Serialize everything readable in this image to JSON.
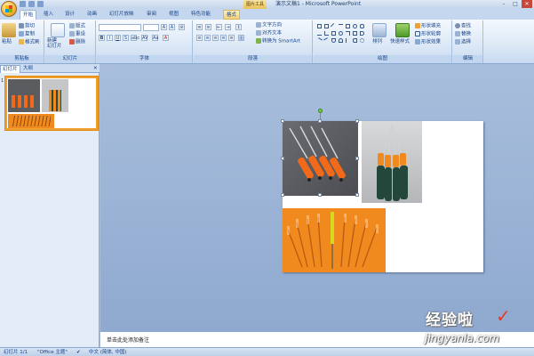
{
  "window": {
    "title": "演示文稿1 - Microsoft PowerPoint",
    "contextual_tab": "图片工具",
    "controls": {
      "minimize": "–",
      "maximize": "□",
      "close": "✕"
    }
  },
  "tabs": [
    "开始",
    "插入",
    "设计",
    "动画",
    "幻灯片放映",
    "审阅",
    "视图",
    "特色功能",
    "格式"
  ],
  "ribbon": {
    "clipboard": {
      "label": "剪贴板",
      "paste": "粘贴",
      "cut": "剪切",
      "copy": "复制",
      "format_painter": "格式刷"
    },
    "slides": {
      "label": "幻灯片",
      "new_slide": "新建\n幻灯片",
      "layout": "版式",
      "reset": "重设",
      "delete": "删除"
    },
    "font": {
      "label": "字体",
      "font_name": "",
      "font_size": ""
    },
    "paragraph": {
      "label": "段落",
      "text_direction": "文字方向",
      "align_text": "对齐文本",
      "smartart": "转换为 SmartArt"
    },
    "drawing": {
      "label": "绘图",
      "arrange": "排列",
      "quick_styles": "快速样式",
      "shape_fill": "形状填充",
      "shape_outline": "形状轮廓",
      "shape_effects": "形状效果"
    },
    "editing": {
      "label": "编辑",
      "find": "查找",
      "replace": "替换",
      "select": "选择"
    }
  },
  "left_panel": {
    "tab_slides": "幻灯片",
    "tab_outline": "大纲",
    "close": "✕",
    "slide_number": "1"
  },
  "notes": {
    "placeholder": "单击此处添加备注"
  },
  "status": {
    "slide_info": "幻灯片 1/1",
    "theme": "\"Office 主题\"",
    "language": "中文 (简体, 中国)"
  },
  "watermark": {
    "brand": "经验啦",
    "check": "✓",
    "url": "jingyanla.com"
  },
  "colors": {
    "ribbon_text": "#15428b",
    "accent_orange": "#f0a030",
    "photo_orange": "#f08a1e",
    "photo_gray": "#5b5c60"
  }
}
